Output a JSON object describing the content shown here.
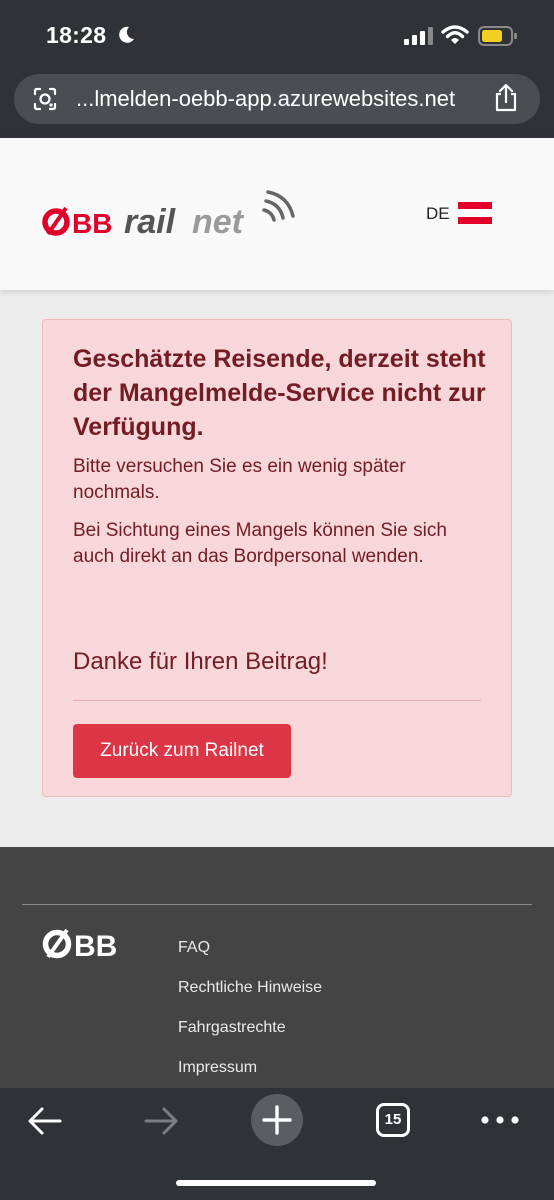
{
  "status_bar": {
    "time": "18:28",
    "icons": [
      "moon-icon",
      "signal-icon",
      "wifi-icon",
      "battery-icon"
    ]
  },
  "browser": {
    "url": "...lmelden-oebb-app.azurewebsites.net",
    "icons": [
      "lens-icon",
      "share-icon"
    ]
  },
  "header": {
    "logo_text": "ÖBB railnet",
    "language": "DE",
    "colors": {
      "brand_red": "#e2002a",
      "gray": "#555555"
    }
  },
  "alert": {
    "heading": "Geschätzte Reisende, derzeit steht der Mangelmelde-Service nicht zur Verfügung.",
    "paragraph1": "Bitte versuchen Sie es ein wenig später nochmals.",
    "paragraph2": "Bei Sichtung eines Mangels können Sie sich auch direkt an das Bordpersonal wenden.",
    "thanks": "Danke für Ihren Beitrag!",
    "button_label": "Zurück zum Railnet",
    "colors": {
      "background": "#f8d7da",
      "text": "#721c24",
      "button": "#dc3545"
    }
  },
  "footer": {
    "logo_text": "ÖBB",
    "links": [
      "FAQ",
      "Rechtliche Hinweise",
      "Fahrgastrechte",
      "Impressum"
    ]
  },
  "toolbar": {
    "tab_count": "15",
    "icons": [
      "back-arrow-icon",
      "forward-arrow-icon",
      "plus-icon",
      "tabs-icon",
      "more-icon"
    ]
  }
}
